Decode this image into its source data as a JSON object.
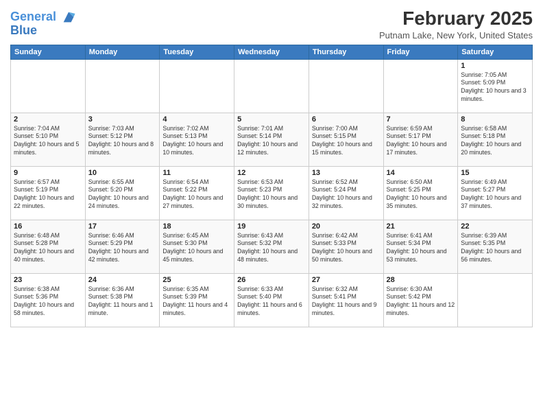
{
  "logo": {
    "line1": "General",
    "line2": "Blue"
  },
  "title": "February 2025",
  "subtitle": "Putnam Lake, New York, United States",
  "weekdays": [
    "Sunday",
    "Monday",
    "Tuesday",
    "Wednesday",
    "Thursday",
    "Friday",
    "Saturday"
  ],
  "weeks": [
    [
      {
        "day": "",
        "info": ""
      },
      {
        "day": "",
        "info": ""
      },
      {
        "day": "",
        "info": ""
      },
      {
        "day": "",
        "info": ""
      },
      {
        "day": "",
        "info": ""
      },
      {
        "day": "",
        "info": ""
      },
      {
        "day": "1",
        "info": "Sunrise: 7:05 AM\nSunset: 5:09 PM\nDaylight: 10 hours and 3 minutes."
      }
    ],
    [
      {
        "day": "2",
        "info": "Sunrise: 7:04 AM\nSunset: 5:10 PM\nDaylight: 10 hours and 5 minutes."
      },
      {
        "day": "3",
        "info": "Sunrise: 7:03 AM\nSunset: 5:12 PM\nDaylight: 10 hours and 8 minutes."
      },
      {
        "day": "4",
        "info": "Sunrise: 7:02 AM\nSunset: 5:13 PM\nDaylight: 10 hours and 10 minutes."
      },
      {
        "day": "5",
        "info": "Sunrise: 7:01 AM\nSunset: 5:14 PM\nDaylight: 10 hours and 12 minutes."
      },
      {
        "day": "6",
        "info": "Sunrise: 7:00 AM\nSunset: 5:15 PM\nDaylight: 10 hours and 15 minutes."
      },
      {
        "day": "7",
        "info": "Sunrise: 6:59 AM\nSunset: 5:17 PM\nDaylight: 10 hours and 17 minutes."
      },
      {
        "day": "8",
        "info": "Sunrise: 6:58 AM\nSunset: 5:18 PM\nDaylight: 10 hours and 20 minutes."
      }
    ],
    [
      {
        "day": "9",
        "info": "Sunrise: 6:57 AM\nSunset: 5:19 PM\nDaylight: 10 hours and 22 minutes."
      },
      {
        "day": "10",
        "info": "Sunrise: 6:55 AM\nSunset: 5:20 PM\nDaylight: 10 hours and 24 minutes."
      },
      {
        "day": "11",
        "info": "Sunrise: 6:54 AM\nSunset: 5:22 PM\nDaylight: 10 hours and 27 minutes."
      },
      {
        "day": "12",
        "info": "Sunrise: 6:53 AM\nSunset: 5:23 PM\nDaylight: 10 hours and 30 minutes."
      },
      {
        "day": "13",
        "info": "Sunrise: 6:52 AM\nSunset: 5:24 PM\nDaylight: 10 hours and 32 minutes."
      },
      {
        "day": "14",
        "info": "Sunrise: 6:50 AM\nSunset: 5:25 PM\nDaylight: 10 hours and 35 minutes."
      },
      {
        "day": "15",
        "info": "Sunrise: 6:49 AM\nSunset: 5:27 PM\nDaylight: 10 hours and 37 minutes."
      }
    ],
    [
      {
        "day": "16",
        "info": "Sunrise: 6:48 AM\nSunset: 5:28 PM\nDaylight: 10 hours and 40 minutes."
      },
      {
        "day": "17",
        "info": "Sunrise: 6:46 AM\nSunset: 5:29 PM\nDaylight: 10 hours and 42 minutes."
      },
      {
        "day": "18",
        "info": "Sunrise: 6:45 AM\nSunset: 5:30 PM\nDaylight: 10 hours and 45 minutes."
      },
      {
        "day": "19",
        "info": "Sunrise: 6:43 AM\nSunset: 5:32 PM\nDaylight: 10 hours and 48 minutes."
      },
      {
        "day": "20",
        "info": "Sunrise: 6:42 AM\nSunset: 5:33 PM\nDaylight: 10 hours and 50 minutes."
      },
      {
        "day": "21",
        "info": "Sunrise: 6:41 AM\nSunset: 5:34 PM\nDaylight: 10 hours and 53 minutes."
      },
      {
        "day": "22",
        "info": "Sunrise: 6:39 AM\nSunset: 5:35 PM\nDaylight: 10 hours and 56 minutes."
      }
    ],
    [
      {
        "day": "23",
        "info": "Sunrise: 6:38 AM\nSunset: 5:36 PM\nDaylight: 10 hours and 58 minutes."
      },
      {
        "day": "24",
        "info": "Sunrise: 6:36 AM\nSunset: 5:38 PM\nDaylight: 11 hours and 1 minute."
      },
      {
        "day": "25",
        "info": "Sunrise: 6:35 AM\nSunset: 5:39 PM\nDaylight: 11 hours and 4 minutes."
      },
      {
        "day": "26",
        "info": "Sunrise: 6:33 AM\nSunset: 5:40 PM\nDaylight: 11 hours and 6 minutes."
      },
      {
        "day": "27",
        "info": "Sunrise: 6:32 AM\nSunset: 5:41 PM\nDaylight: 11 hours and 9 minutes."
      },
      {
        "day": "28",
        "info": "Sunrise: 6:30 AM\nSunset: 5:42 PM\nDaylight: 11 hours and 12 minutes."
      },
      {
        "day": "",
        "info": ""
      }
    ]
  ]
}
